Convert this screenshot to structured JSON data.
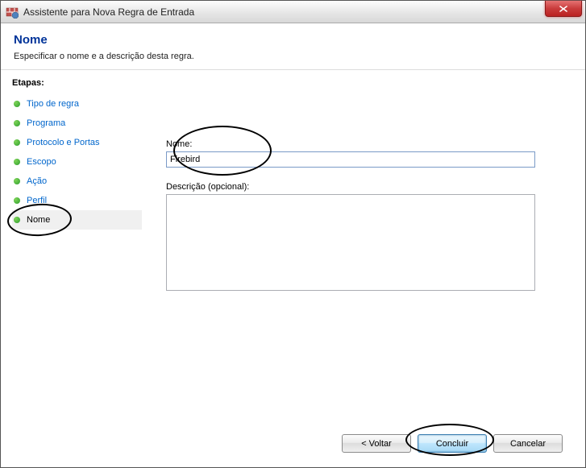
{
  "window": {
    "title": "Assistente para Nova Regra de Entrada",
    "close": "X"
  },
  "header": {
    "title": "Nome",
    "subtitle": "Especificar o nome e a descrição desta regra."
  },
  "sidebar": {
    "title": "Etapas:",
    "steps": [
      {
        "label": "Tipo de regra"
      },
      {
        "label": "Programa"
      },
      {
        "label": "Protocolo e Portas"
      },
      {
        "label": "Escopo"
      },
      {
        "label": "Ação"
      },
      {
        "label": "Perfil"
      },
      {
        "label": "Nome"
      }
    ]
  },
  "form": {
    "name_label": "Nome:",
    "name_value": "Firebird",
    "desc_label": "Descrição (opcional):",
    "desc_value": ""
  },
  "buttons": {
    "back": "< Voltar",
    "finish": "Concluir",
    "cancel": "Cancelar"
  }
}
